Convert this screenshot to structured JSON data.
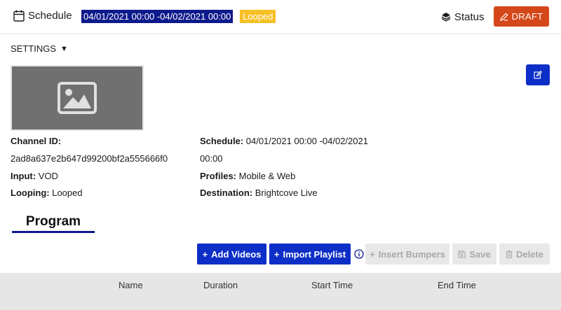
{
  "header": {
    "title": "Schedule",
    "date_range": "04/01/2021 00:00 -04/02/2021 00:00",
    "looped_badge": "Looped",
    "status_label": "Status",
    "draft_label": "DRAFT"
  },
  "settings": {
    "toggle_label": "SETTINGS",
    "caret": "▼"
  },
  "details": {
    "channel_id_label": "Channel ID:",
    "channel_id_value": "2ad8a637e2b647d99200bf2a555666f0",
    "input_label": "Input:",
    "input_value": "VOD",
    "looping_label": "Looping:",
    "looping_value": "Looped",
    "schedule_label": "Schedule:",
    "schedule_value_line1": "04/01/2021 00:00 -04/02/2021",
    "schedule_value_line2": "00:00",
    "profiles_label": "Profiles:",
    "profiles_value": "Mobile & Web",
    "destination_label": "Destination:",
    "destination_value": "Brightcove Live"
  },
  "program": {
    "tab_label": "Program",
    "buttons": {
      "add_videos": "Add Videos",
      "import_playlist": "Import Playlist",
      "insert_bumpers": "Insert Bumpers",
      "save": "Save",
      "delete": "Delete"
    },
    "columns": [
      "Name",
      "Duration",
      "Start Time",
      "End Time"
    ]
  },
  "icons": {
    "calendar": "calendar-icon",
    "layers": "layers-icon",
    "pencil": "pencil-icon",
    "image_placeholder": "image-placeholder-icon",
    "info": "info-icon",
    "save": "save-icon",
    "trash": "trash-icon"
  },
  "colors": {
    "navy": "#0d1a8c",
    "primary_blue": "#0d2fc7",
    "draft_orange": "#d4471a",
    "looped_yellow": "#f6c026",
    "disabled_gray": "#e8e8e8",
    "table_header_gray": "#e6e6e6"
  }
}
